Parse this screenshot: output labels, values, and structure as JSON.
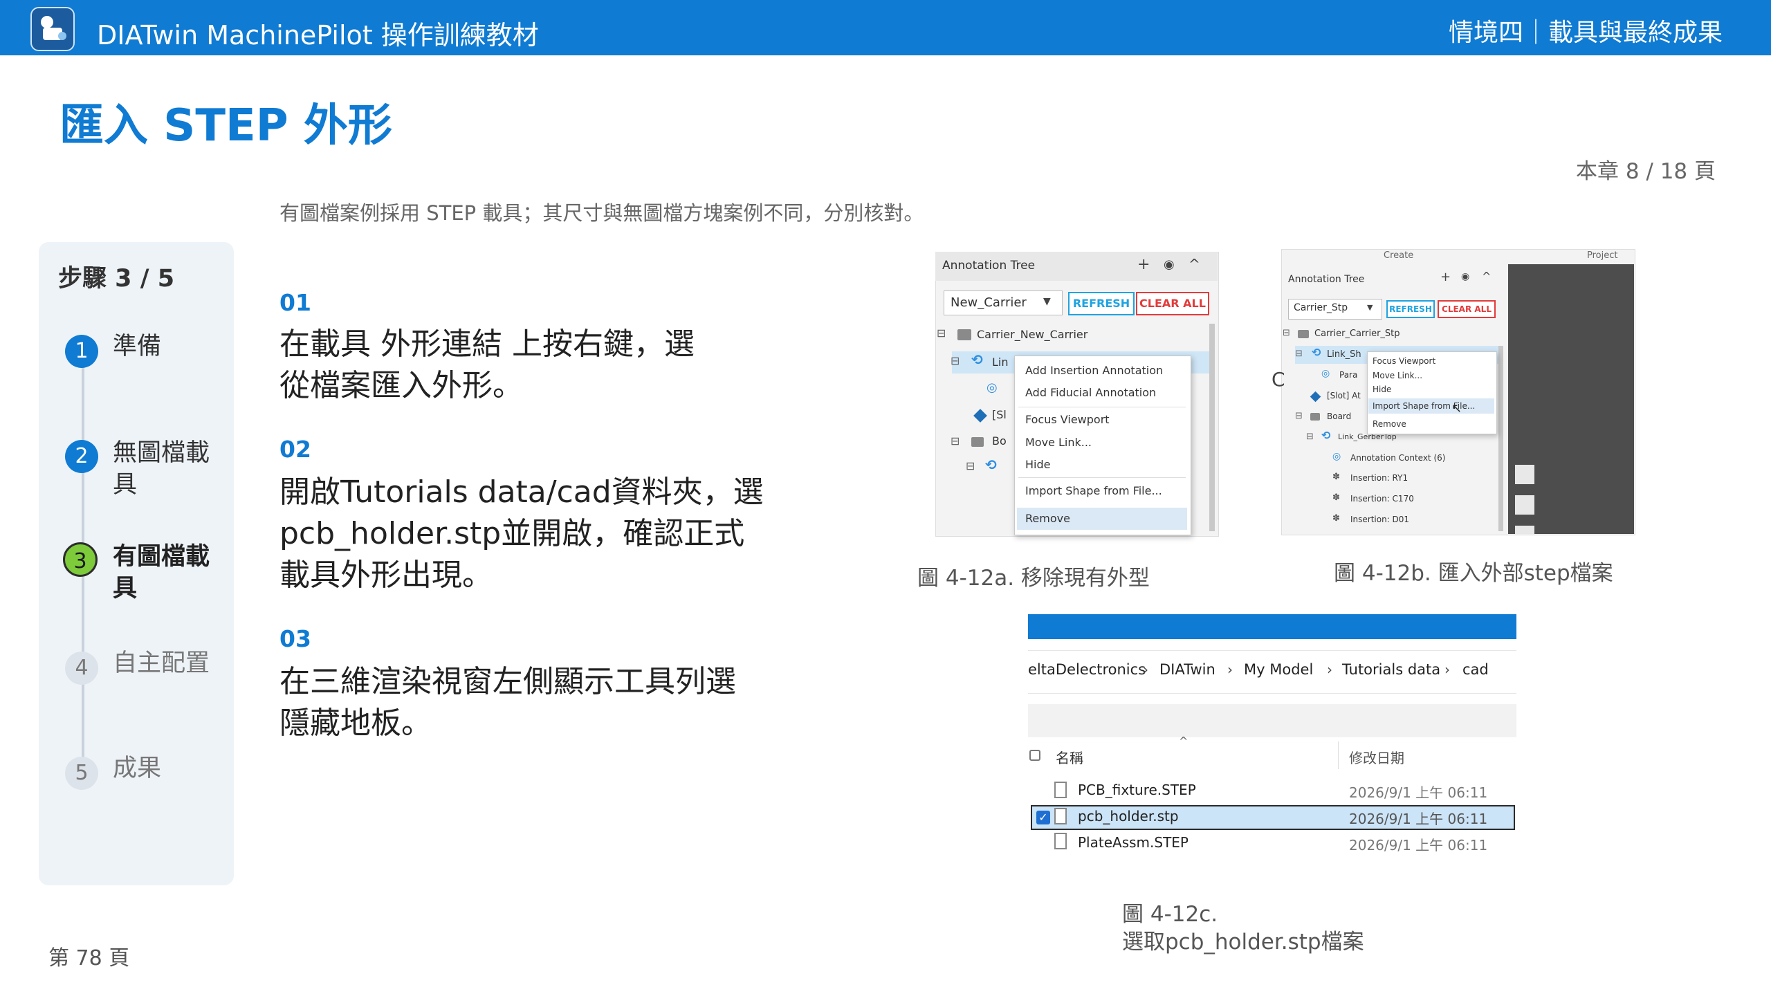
{
  "header": {
    "app_title": "DIATwin MachinePilot 操作訓練教材",
    "chapter_title": "情境四｜載具與最終成果"
  },
  "page": {
    "title": "匯入 STEP 外形",
    "chapter_pages": "本章 8 / 18 頁",
    "intro": "有圖檔案例採用 STEP 載具；其尺寸與無圖檔方塊案例不同，分別核對。",
    "footer_page": "第 78 頁"
  },
  "stepper": {
    "heading": "步驟 3 / 5",
    "steps": [
      {
        "num": "1",
        "label": "準備"
      },
      {
        "num": "2",
        "label": "無圖檔載具"
      },
      {
        "num": "3",
        "label": "有圖檔載具"
      },
      {
        "num": "4",
        "label": "自主配置"
      },
      {
        "num": "5",
        "label": "成果"
      }
    ]
  },
  "content_steps": [
    {
      "num": "01",
      "text": "在載具 外形連結 上按右鍵，選從檔案匯入外形。"
    },
    {
      "num": "02",
      "text": "開啟Tutorials data/cad資料夾，選pcb_holder.stp並開啟，確認正式載具外形出現。"
    },
    {
      "num": "03",
      "text": "在三維渲染視窗左側顯示工具列選隱藏地板。"
    }
  ],
  "fig_a": {
    "caption": "圖 4-12a. 移除現有外型",
    "tree_title": "Annotation Tree",
    "select_value": "New_Carrier",
    "refresh": "REFRESH",
    "clear_all": "CLEAR ALL",
    "carrier_row": "Carrier_New_Carrier",
    "row_link": "Lin",
    "row_slot": "[Sl",
    "row_board": "Bo",
    "menu": [
      "Add Insertion Annotation",
      "Add Fiducial Annotation",
      "Focus Viewport",
      "Move Link...",
      "Hide",
      "Import Shape from File...",
      "Remove"
    ]
  },
  "fig_b": {
    "caption": "圖 4-12b. 匯入外部step檔案",
    "top_left": "Create",
    "top_right": "Project",
    "tree_title": "Annotation Tree",
    "select_value": "Carrier_Stp",
    "refresh": "REFRESH",
    "clear_all": "CLEAR ALL",
    "rows": [
      "Carrier_Carrier_Stp",
      "Link_Sh",
      "Para",
      "[Slot] At",
      "Board",
      "Link_GerberTop",
      "Annotation Context (6)",
      "Insertion: RY1",
      "Insertion: C170",
      "Insertion: D01"
    ],
    "stray": "C",
    "menu": [
      "Focus Viewport",
      "Move Link...",
      "Hide",
      "Import Shape from File...",
      "Remove"
    ]
  },
  "fig_c": {
    "caption_line1": "圖 4-12c.",
    "caption_line2": "選取pcb_holder.stp檔案",
    "breadcrumb": [
      "eltaDelectronics",
      "DIATwin",
      "My Model",
      "Tutorials data",
      "cad"
    ],
    "col_name": "名稱",
    "col_date": "修改日期",
    "files": [
      {
        "name": "PCB_fixture.STEP",
        "date": "2026/9/1 上午 06:11"
      },
      {
        "name": "pcb_holder.stp",
        "date": "2026/9/1 上午 06:11"
      },
      {
        "name": "PlateAssm.STEP",
        "date": "2026/9/1 上午 06:11"
      }
    ]
  },
  "colors": {
    "accent": "#0F7BD3",
    "current_step": "#7DCB3B",
    "refresh": "#1fa3e0",
    "clear_all": "#e23b3b"
  }
}
